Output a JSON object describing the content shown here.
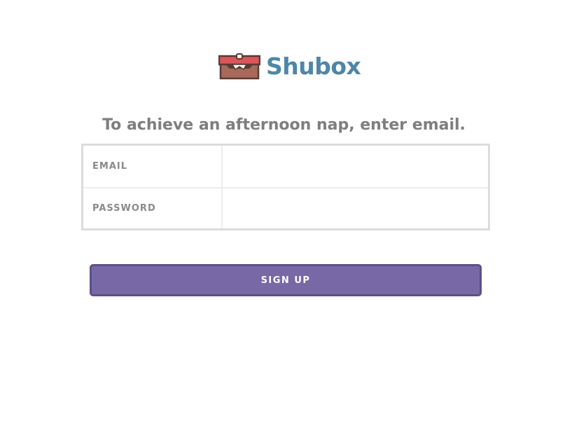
{
  "brand": {
    "name": "Shubox",
    "logo_icon": "treasure-chest-icon",
    "color": "#4f86a8"
  },
  "tagline": "To achieve an afternoon nap, enter email.",
  "form": {
    "email_label": "EMAIL",
    "email_value": "",
    "password_label": "PASSWORD",
    "password_value": ""
  },
  "signup_button": {
    "label": "SIGN UP",
    "color": "#7868a6"
  }
}
